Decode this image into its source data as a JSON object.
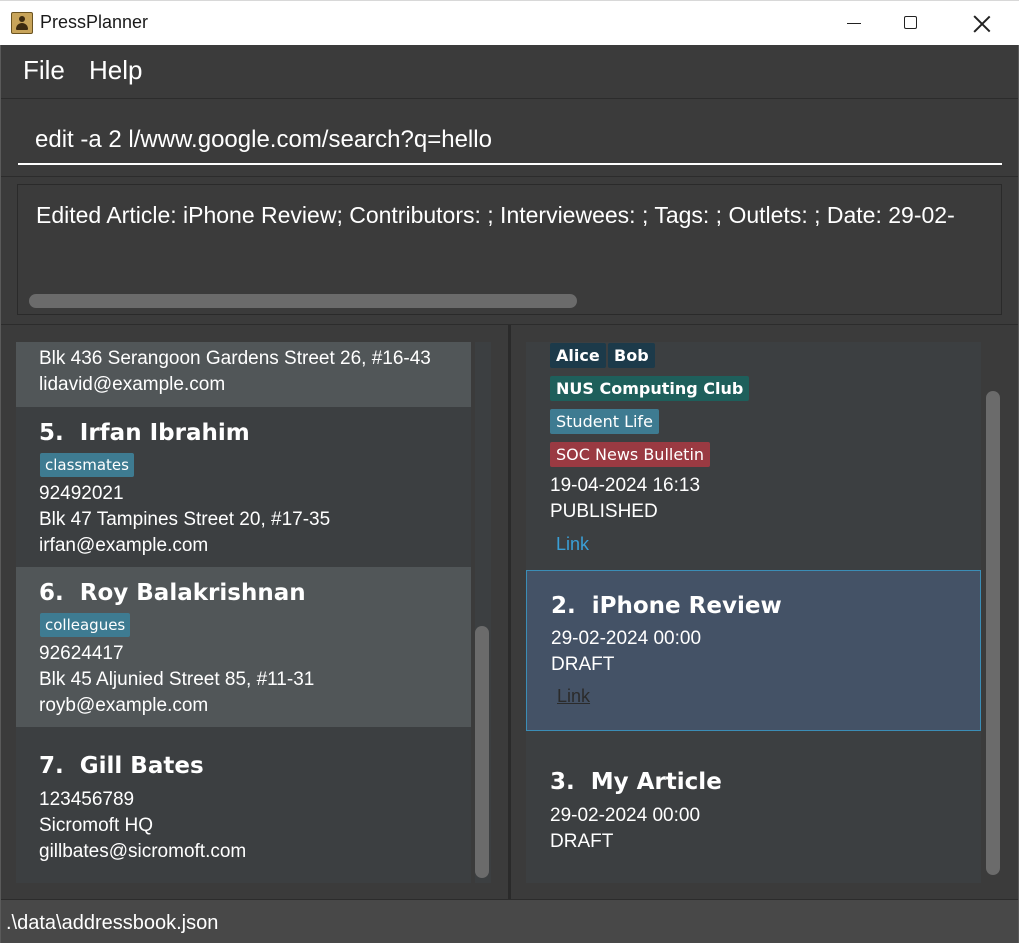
{
  "window": {
    "title": "PressPlanner"
  },
  "menu": {
    "file": "File",
    "help": "Help"
  },
  "command": {
    "value": "edit -a 2 l/www.google.com/search?q=hello"
  },
  "result": {
    "text": "Edited Article: iPhone Review; Contributors: ; Interviewees: ; Tags: ; Outlets: ; Date: 29-02-"
  },
  "persons": [
    {
      "address": "Blk 436 Serangoon Gardens Street 26, #16-43",
      "email": "lidavid@example.com"
    },
    {
      "index": "5.",
      "name": "Irfan Ibrahim",
      "tag": "classmates",
      "phone": "92492021",
      "address": "Blk 47 Tampines Street 20, #17-35",
      "email": "irfan@example.com"
    },
    {
      "index": "6.",
      "name": "Roy Balakrishnan",
      "tag": "colleagues",
      "phone": "92624417",
      "address": "Blk 45 Aljunied Street 85, #11-31",
      "email": "royb@example.com"
    },
    {
      "index": "7.",
      "name": "Gill Bates",
      "phone": "123456789",
      "address": "Sicromoft HQ",
      "email": "gillbates@sicromoft.com"
    }
  ],
  "articles": {
    "first": {
      "contributors": [
        "Alice",
        "Bob"
      ],
      "interviewee": "NUS Computing Club",
      "tag": "Student Life",
      "outlet": "SOC News Bulletin",
      "date": "19-04-2024 16:13",
      "status": "PUBLISHED",
      "link": "Link"
    },
    "second": {
      "index": "2.",
      "title": "iPhone Review",
      "date": "29-02-2024 00:00",
      "status": "DRAFT",
      "link": "Link"
    },
    "third": {
      "index": "3.",
      "title": "My Article",
      "date": "29-02-2024 00:00",
      "status": "DRAFT"
    }
  },
  "status": {
    "path": ".\\data\\addressbook.json"
  },
  "colors": {
    "background": "#3b3b3b",
    "card_alt": "#515658",
    "selected_card": "#445266",
    "tag_blue": "#3e7b91",
    "contributor_chip": "#1c3a4a",
    "interviewee_chip": "#1e5f5b",
    "outlet_chip": "#9a3a42",
    "link": "#3a9fd6"
  }
}
